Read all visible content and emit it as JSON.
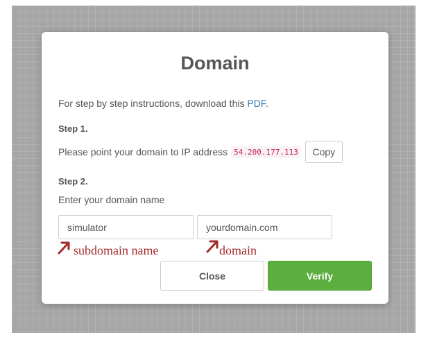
{
  "dialog": {
    "title": "Domain",
    "instructions_prefix": "For step by step instructions, download this ",
    "instructions_link": "PDF",
    "instructions_suffix": "."
  },
  "step1": {
    "heading": "Step 1.",
    "text": "Please point your domain to IP address",
    "ip_address": "54.200.177.113",
    "copy_label": "Copy"
  },
  "step2": {
    "heading": "Step 2.",
    "label": "Enter your domain name",
    "subdomain_value": "simulator",
    "domain_value": "yourdomain.com"
  },
  "annotations": {
    "subdomain": "subdomain name",
    "domain": "domain",
    "color": "#a32a2a"
  },
  "buttons": {
    "close_label": "Close",
    "verify_label": "Verify"
  },
  "colors": {
    "backdrop": "#a6a6a6",
    "link": "#2a7ab8",
    "verify": "#5cae3f",
    "code": "#c7254e"
  }
}
